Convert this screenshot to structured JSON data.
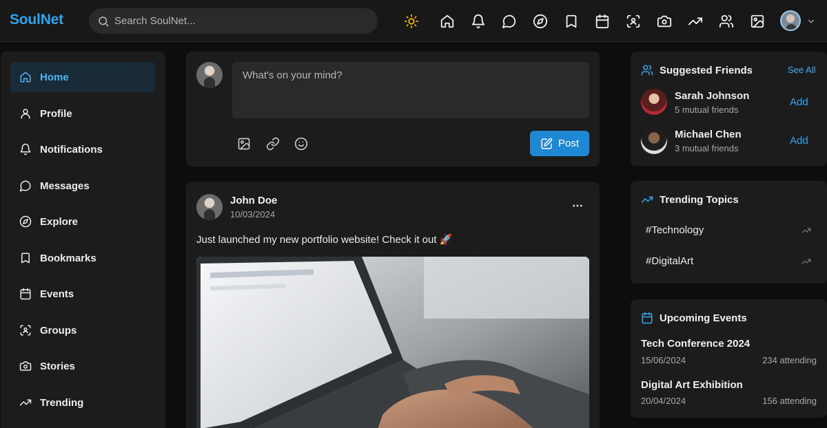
{
  "app": {
    "name": "SoulNet"
  },
  "search": {
    "placeholder": "Search SoulNet..."
  },
  "topnav": [
    {
      "icon": "sun-icon"
    },
    {
      "icon": "home-icon"
    },
    {
      "icon": "bell-icon"
    },
    {
      "icon": "message-icon"
    },
    {
      "icon": "compass-icon"
    },
    {
      "icon": "bookmark-icon"
    },
    {
      "icon": "calendar-icon"
    },
    {
      "icon": "groups-icon"
    },
    {
      "icon": "camera-icon"
    },
    {
      "icon": "trending-icon"
    },
    {
      "icon": "users-icon"
    },
    {
      "icon": "image-icon"
    }
  ],
  "sidebar": {
    "items": [
      {
        "label": "Home",
        "icon": "home-icon",
        "active": true
      },
      {
        "label": "Profile",
        "icon": "user-icon"
      },
      {
        "label": "Notifications",
        "icon": "bell-icon"
      },
      {
        "label": "Messages",
        "icon": "message-icon"
      },
      {
        "label": "Explore",
        "icon": "compass-icon"
      },
      {
        "label": "Bookmarks",
        "icon": "bookmark-icon"
      },
      {
        "label": "Events",
        "icon": "calendar-icon"
      },
      {
        "label": "Groups",
        "icon": "groups-icon"
      },
      {
        "label": "Stories",
        "icon": "camera-icon"
      },
      {
        "label": "Trending",
        "icon": "trending-icon"
      }
    ]
  },
  "composer": {
    "placeholder": "What's on your mind?",
    "post_label": "Post"
  },
  "post": {
    "author": "John Doe",
    "date": "10/03/2024",
    "text": "Just launched my new portfolio website! Check it out 🚀"
  },
  "suggested": {
    "title": "Suggested Friends",
    "see_all": "See All",
    "friends": [
      {
        "name": "Sarah Johnson",
        "mutual": "5 mutual friends",
        "action": "Add"
      },
      {
        "name": "Michael Chen",
        "mutual": "3 mutual friends",
        "action": "Add"
      }
    ]
  },
  "trending": {
    "title": "Trending Topics",
    "topics": [
      "#Technology",
      "#DigitalArt"
    ]
  },
  "events": {
    "title": "Upcoming Events",
    "items": [
      {
        "name": "Tech Conference 2024",
        "date": "15/06/2024",
        "attending": "234 attending"
      },
      {
        "name": "Digital Art Exhibition",
        "date": "20/04/2024",
        "attending": "156 attending"
      }
    ]
  },
  "colors": {
    "accent": "#1f88d4",
    "brand": "#32a4ee",
    "sun": "#f5b80a",
    "background": "#0d0d0d",
    "card": "#1c1c1c"
  }
}
